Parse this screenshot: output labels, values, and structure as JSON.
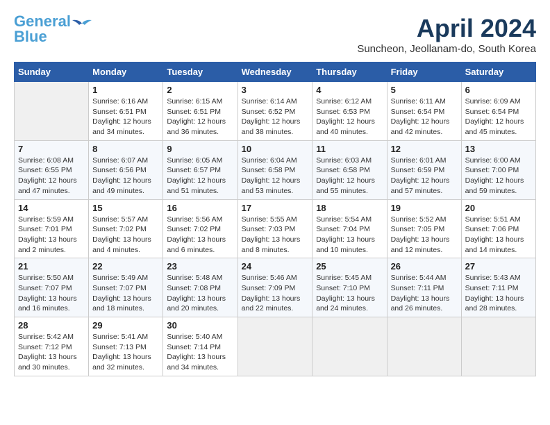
{
  "header": {
    "logo_line1": "General",
    "logo_line2": "Blue",
    "month": "April 2024",
    "location": "Suncheon, Jeollanam-do, South Korea"
  },
  "weekdays": [
    "Sunday",
    "Monday",
    "Tuesday",
    "Wednesday",
    "Thursday",
    "Friday",
    "Saturday"
  ],
  "weeks": [
    [
      {
        "day": "",
        "info": ""
      },
      {
        "day": "1",
        "info": "Sunrise: 6:16 AM\nSunset: 6:51 PM\nDaylight: 12 hours\nand 34 minutes."
      },
      {
        "day": "2",
        "info": "Sunrise: 6:15 AM\nSunset: 6:51 PM\nDaylight: 12 hours\nand 36 minutes."
      },
      {
        "day": "3",
        "info": "Sunrise: 6:14 AM\nSunset: 6:52 PM\nDaylight: 12 hours\nand 38 minutes."
      },
      {
        "day": "4",
        "info": "Sunrise: 6:12 AM\nSunset: 6:53 PM\nDaylight: 12 hours\nand 40 minutes."
      },
      {
        "day": "5",
        "info": "Sunrise: 6:11 AM\nSunset: 6:54 PM\nDaylight: 12 hours\nand 42 minutes."
      },
      {
        "day": "6",
        "info": "Sunrise: 6:09 AM\nSunset: 6:54 PM\nDaylight: 12 hours\nand 45 minutes."
      }
    ],
    [
      {
        "day": "7",
        "info": "Sunrise: 6:08 AM\nSunset: 6:55 PM\nDaylight: 12 hours\nand 47 minutes."
      },
      {
        "day": "8",
        "info": "Sunrise: 6:07 AM\nSunset: 6:56 PM\nDaylight: 12 hours\nand 49 minutes."
      },
      {
        "day": "9",
        "info": "Sunrise: 6:05 AM\nSunset: 6:57 PM\nDaylight: 12 hours\nand 51 minutes."
      },
      {
        "day": "10",
        "info": "Sunrise: 6:04 AM\nSunset: 6:58 PM\nDaylight: 12 hours\nand 53 minutes."
      },
      {
        "day": "11",
        "info": "Sunrise: 6:03 AM\nSunset: 6:58 PM\nDaylight: 12 hours\nand 55 minutes."
      },
      {
        "day": "12",
        "info": "Sunrise: 6:01 AM\nSunset: 6:59 PM\nDaylight: 12 hours\nand 57 minutes."
      },
      {
        "day": "13",
        "info": "Sunrise: 6:00 AM\nSunset: 7:00 PM\nDaylight: 12 hours\nand 59 minutes."
      }
    ],
    [
      {
        "day": "14",
        "info": "Sunrise: 5:59 AM\nSunset: 7:01 PM\nDaylight: 13 hours\nand 2 minutes."
      },
      {
        "day": "15",
        "info": "Sunrise: 5:57 AM\nSunset: 7:02 PM\nDaylight: 13 hours\nand 4 minutes."
      },
      {
        "day": "16",
        "info": "Sunrise: 5:56 AM\nSunset: 7:02 PM\nDaylight: 13 hours\nand 6 minutes."
      },
      {
        "day": "17",
        "info": "Sunrise: 5:55 AM\nSunset: 7:03 PM\nDaylight: 13 hours\nand 8 minutes."
      },
      {
        "day": "18",
        "info": "Sunrise: 5:54 AM\nSunset: 7:04 PM\nDaylight: 13 hours\nand 10 minutes."
      },
      {
        "day": "19",
        "info": "Sunrise: 5:52 AM\nSunset: 7:05 PM\nDaylight: 13 hours\nand 12 minutes."
      },
      {
        "day": "20",
        "info": "Sunrise: 5:51 AM\nSunset: 7:06 PM\nDaylight: 13 hours\nand 14 minutes."
      }
    ],
    [
      {
        "day": "21",
        "info": "Sunrise: 5:50 AM\nSunset: 7:07 PM\nDaylight: 13 hours\nand 16 minutes."
      },
      {
        "day": "22",
        "info": "Sunrise: 5:49 AM\nSunset: 7:07 PM\nDaylight: 13 hours\nand 18 minutes."
      },
      {
        "day": "23",
        "info": "Sunrise: 5:48 AM\nSunset: 7:08 PM\nDaylight: 13 hours\nand 20 minutes."
      },
      {
        "day": "24",
        "info": "Sunrise: 5:46 AM\nSunset: 7:09 PM\nDaylight: 13 hours\nand 22 minutes."
      },
      {
        "day": "25",
        "info": "Sunrise: 5:45 AM\nSunset: 7:10 PM\nDaylight: 13 hours\nand 24 minutes."
      },
      {
        "day": "26",
        "info": "Sunrise: 5:44 AM\nSunset: 7:11 PM\nDaylight: 13 hours\nand 26 minutes."
      },
      {
        "day": "27",
        "info": "Sunrise: 5:43 AM\nSunset: 7:11 PM\nDaylight: 13 hours\nand 28 minutes."
      }
    ],
    [
      {
        "day": "28",
        "info": "Sunrise: 5:42 AM\nSunset: 7:12 PM\nDaylight: 13 hours\nand 30 minutes."
      },
      {
        "day": "29",
        "info": "Sunrise: 5:41 AM\nSunset: 7:13 PM\nDaylight: 13 hours\nand 32 minutes."
      },
      {
        "day": "30",
        "info": "Sunrise: 5:40 AM\nSunset: 7:14 PM\nDaylight: 13 hours\nand 34 minutes."
      },
      {
        "day": "",
        "info": ""
      },
      {
        "day": "",
        "info": ""
      },
      {
        "day": "",
        "info": ""
      },
      {
        "day": "",
        "info": ""
      }
    ]
  ]
}
